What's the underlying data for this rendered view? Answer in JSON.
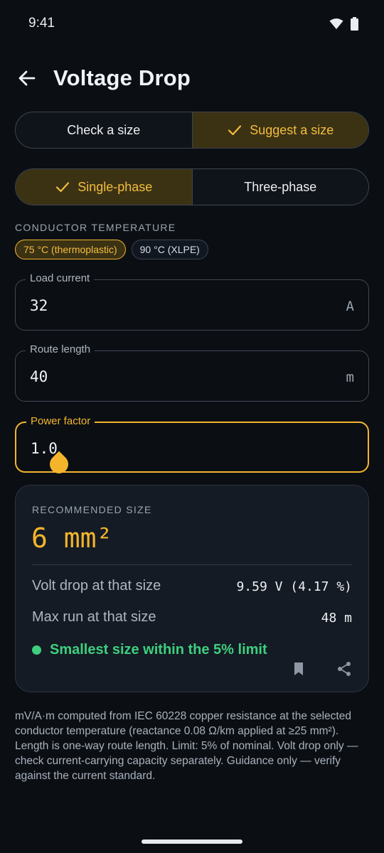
{
  "status_bar": {
    "time": "9:41"
  },
  "app_bar": {
    "title": "Voltage Drop"
  },
  "mode_toggle": {
    "options": [
      "Check a size",
      "Suggest a size"
    ],
    "selected": "Suggest a size"
  },
  "phase_toggle": {
    "options": [
      "Single-phase",
      "Three-phase"
    ],
    "selected": "Single-phase"
  },
  "conductor_temperature": {
    "label": "CONDUCTOR TEMPERATURE",
    "options": [
      "75 °C (thermoplastic)",
      "90 °C (XLPE)"
    ],
    "selected": "75 °C (thermoplastic)"
  },
  "fields": {
    "load_current": {
      "label": "Load current",
      "value": "32",
      "unit": "A"
    },
    "route_length": {
      "label": "Route length",
      "value": "40",
      "unit": "m"
    },
    "power_factor": {
      "label": "Power factor",
      "value": "1.0"
    }
  },
  "result": {
    "label": "RECOMMENDED SIZE",
    "size": "6 mm²",
    "rows": [
      {
        "label": "Volt drop at that size",
        "value": "9.59 V (4.17 %)"
      },
      {
        "label": "Max run at that size",
        "value": "48 m"
      }
    ],
    "status": "Smallest size within the 5% limit",
    "status_color": "#3ecf7e"
  },
  "footnote": "mV/A·m computed from IEC 60228 copper resistance at the selected conductor temperature (reactance 0.08 Ω/km applied at ≥25 mm²). Length is one-way route length. Limit: 5% of nominal. Volt drop only — check current-carrying capacity separately. Guidance only — verify against the current standard.",
  "colors": {
    "accent": "#f4b52c",
    "background": "#0b0f14",
    "card": "#141b24",
    "success": "#3ecf7e"
  },
  "icons": [
    "wifi-icon",
    "battery-icon",
    "back-arrow-icon",
    "check-icon",
    "bookmark-icon",
    "share-icon"
  ]
}
